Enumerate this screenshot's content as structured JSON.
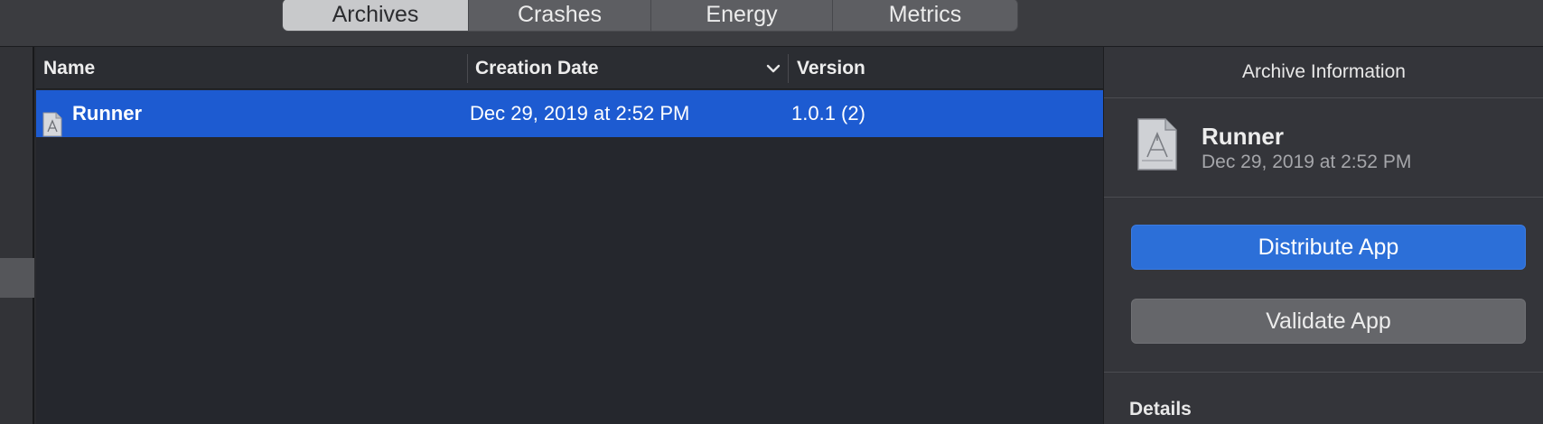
{
  "toolbar": {
    "tabs": [
      {
        "label": "Archives",
        "active": true
      },
      {
        "label": "Crashes",
        "active": false
      },
      {
        "label": "Energy",
        "active": false
      },
      {
        "label": "Metrics",
        "active": false
      }
    ]
  },
  "table": {
    "columns": {
      "name": "Name",
      "creation_date": "Creation Date",
      "version": "Version"
    },
    "sort_icon": "chevron-down-icon",
    "rows": [
      {
        "name": "Runner",
        "creation_date": "Dec 29, 2019 at 2:52 PM",
        "version": "1.0.1 (2)",
        "selected": true,
        "icon": "archive-icon"
      }
    ]
  },
  "inspector": {
    "title": "Archive Information",
    "archive_name": "Runner",
    "archive_date": "Dec 29, 2019 at 2:52 PM",
    "distribute_label": "Distribute App",
    "validate_label": "Validate App",
    "details_label": "Details"
  },
  "colors": {
    "selection": "#1d5bd1",
    "primary_button": "#2c6fd8",
    "secondary_button": "#65666a"
  }
}
